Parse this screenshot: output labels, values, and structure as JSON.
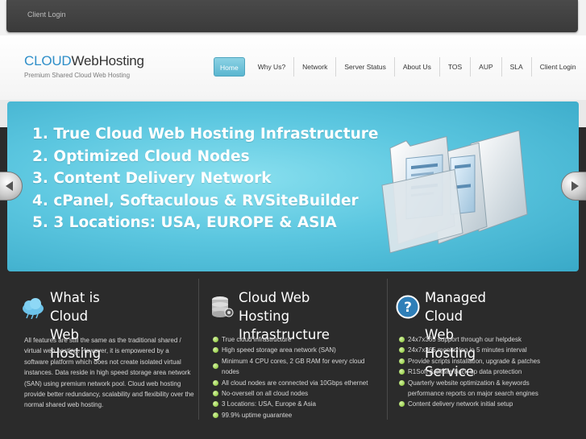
{
  "topbar": {
    "client_login": "Client Login"
  },
  "logo": {
    "brand_part1": "CLOUD",
    "brand_part2": "WebHosting",
    "tagline": "Premium Shared Cloud Web Hosting"
  },
  "nav": {
    "items": [
      {
        "label": "Home",
        "active": true
      },
      {
        "label": "Why Us?"
      },
      {
        "label": "Network"
      },
      {
        "label": "Server Status"
      },
      {
        "label": "About Us"
      },
      {
        "label": "TOS"
      },
      {
        "label": "AUP"
      },
      {
        "label": "SLA"
      },
      {
        "label": "Client Login"
      }
    ]
  },
  "banner": {
    "lines": [
      "1. True Cloud Web Hosting Infrastructure",
      "2. Optimized Cloud Nodes",
      "3. Content Delivery Network",
      "4. cPanel, Softaculous & RVSiteBuilder",
      "5. 3 Locations: USA, EUROPE & ASIA"
    ]
  },
  "columns": {
    "what": {
      "title_line1": "What is Cloud Web",
      "title_line2": "Hosting",
      "text_lines": [
        "All features are still the same as the traditional shared /",
        "virtual web hosting. However, it is empowered by a",
        "software platform which does not create isolated virtual",
        "instances. Data reside in high speed storage area network",
        "(SAN) using premium network pool. Cloud web hosting",
        "provide better redundancy, scalability and flexibility over the",
        "normal shared web hosting."
      ]
    },
    "infra": {
      "title_line1": "Cloud Web Hosting",
      "title_line2": "Infrastructure",
      "items": [
        "True cloud infrastructure",
        "High speed storage area network (SAN)",
        "Minimum 4 CPU cores, 2 GB RAM for every cloud nodes",
        "All cloud nodes are connected via 10Gbps ethernet",
        "No-oversell on all cloud nodes",
        "3 Locations: USA, Europe & Asia",
        "99.9% uptime guarantee"
      ]
    },
    "managed": {
      "title_line1": "Managed Cloud Web",
      "title_line2": "Hosting Service",
      "items": [
        "24x7x365 support through our helpdesk",
        "24x7x365 monitoring in 5 minutes interval",
        "Provide scripts installation, upgrade & patches",
        "R1Soft & offsite back-up data protection",
        "Quarterly website optimization & keywords performance reports on major search engines",
        "Content delivery network initial setup"
      ]
    }
  }
}
